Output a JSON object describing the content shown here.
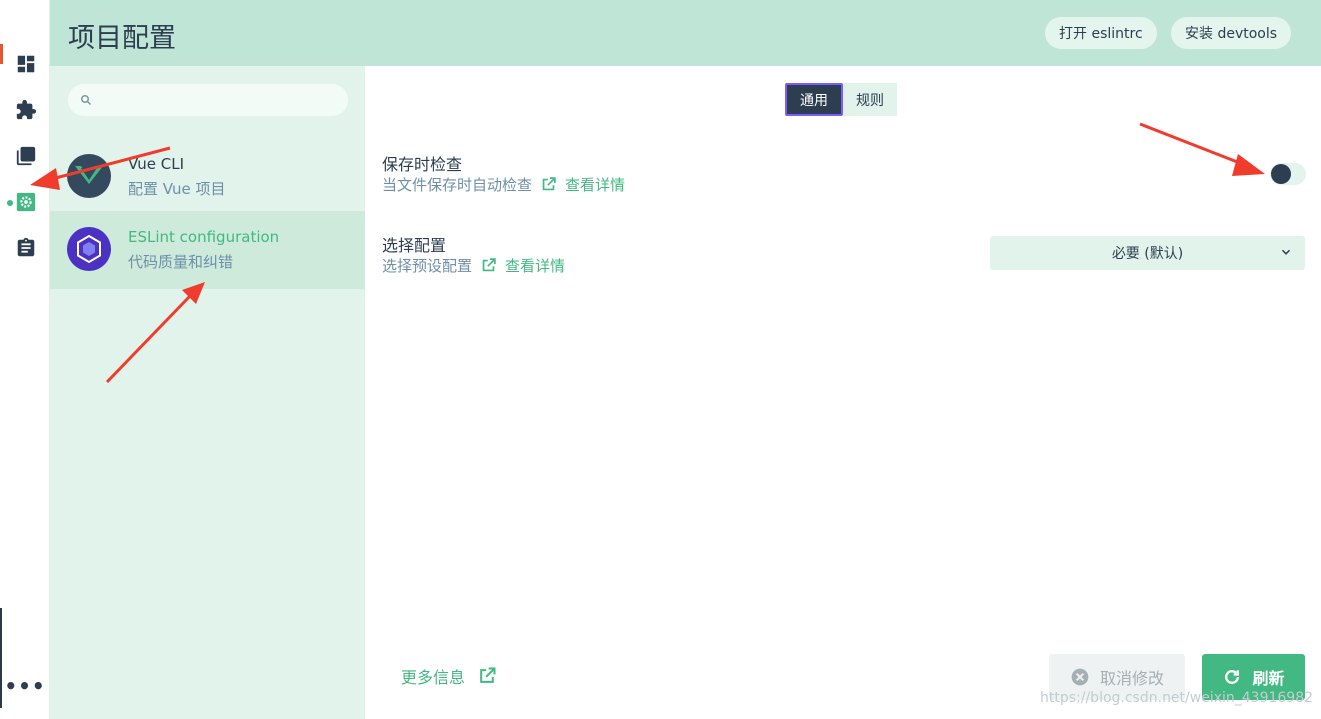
{
  "header": {
    "title": "项目配置",
    "open_eslintrc_label": "打开 eslintrc",
    "install_devtools_label": "安装 devtools"
  },
  "rail": {
    "items": [
      {
        "icon": "dashboard-icon"
      },
      {
        "icon": "puzzle-plugin-icon"
      },
      {
        "icon": "library-dependencies-icon"
      },
      {
        "icon": "gear-configuration-icon",
        "active": true
      },
      {
        "icon": "clipboard-tasks-icon"
      }
    ],
    "more_label": "•••"
  },
  "search": {
    "placeholder": "",
    "value": ""
  },
  "plugins": [
    {
      "name": "Vue CLI",
      "description": "配置 Vue 项目",
      "logo": "vue-logo-icon",
      "selected": false
    },
    {
      "name": "ESLint configuration",
      "description": "代码质量和纠错",
      "logo": "eslint-logo-icon",
      "selected": true
    }
  ],
  "tabs": [
    {
      "label": "通用",
      "active": true
    },
    {
      "label": "规则",
      "active": false
    }
  ],
  "settings": {
    "lint_on_save": {
      "label": "保存时检查",
      "description": "当文件保存时自动检查",
      "details_link": "查看详情",
      "enabled": false
    },
    "config": {
      "label": "选择配置",
      "description": "选择预设配置",
      "details_link": "查看详情",
      "selected": "必要 (默认)"
    }
  },
  "footer": {
    "more_info_label": "更多信息",
    "cancel_label": "取消修改",
    "refresh_label": "刷新"
  },
  "watermark": "https://blog.csdn.net/weixin_43916982",
  "colors": {
    "accent": "#42b983",
    "header_bg": "#bfe5d6",
    "sidebar_bg": "#e1f3eb",
    "dark": "#2c3e50",
    "annotation_arrow": "#f03c2c"
  }
}
